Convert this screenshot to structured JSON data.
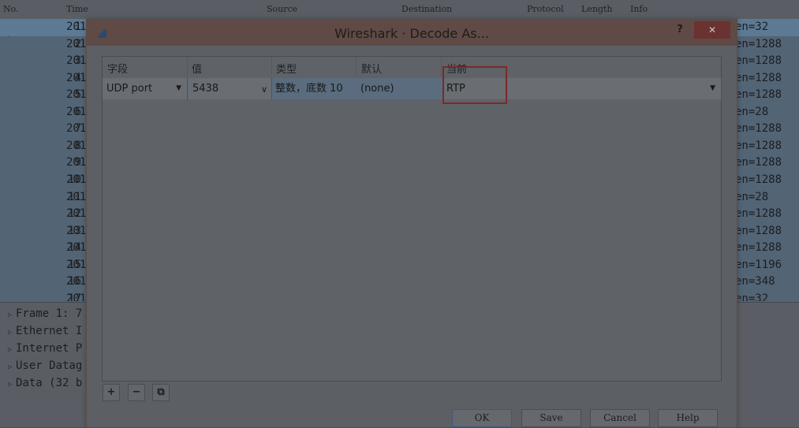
{
  "main": {
    "columns": [
      "No.",
      "Time",
      "Source",
      "Destination",
      "Protocol",
      "Length",
      "Info"
    ],
    "packets": [
      {
        "no": "1",
        "time": "201",
        "info": "en=32"
      },
      {
        "no": "2",
        "time": "201",
        "info": "en=1288"
      },
      {
        "no": "3",
        "time": "201",
        "info": "en=1288"
      },
      {
        "no": "4",
        "time": "201",
        "info": "en=1288"
      },
      {
        "no": "5",
        "time": "201",
        "info": "en=1288"
      },
      {
        "no": "6",
        "time": "201",
        "info": "en=28"
      },
      {
        "no": "7",
        "time": "201",
        "info": "en=1288"
      },
      {
        "no": "8",
        "time": "201",
        "info": "en=1288"
      },
      {
        "no": "9",
        "time": "201",
        "info": "en=1288"
      },
      {
        "no": "10",
        "time": "201",
        "info": "en=1288"
      },
      {
        "no": "11",
        "time": "201",
        "info": "en=28"
      },
      {
        "no": "12",
        "time": "201",
        "info": "en=1288"
      },
      {
        "no": "13",
        "time": "201",
        "info": "en=1288"
      },
      {
        "no": "14",
        "time": "201",
        "info": "en=1288"
      },
      {
        "no": "15",
        "time": "201",
        "info": "en=1196"
      },
      {
        "no": "16",
        "time": "201",
        "info": "en=348"
      },
      {
        "no": "17",
        "time": "201",
        "info": "en=32"
      }
    ],
    "details": [
      "Frame 1: 7",
      "Ethernet I",
      "Internet P",
      "User Datag",
      "Data (32 b"
    ]
  },
  "dialog": {
    "title": "Wireshark · Decode As...",
    "help_label": "?",
    "close_label": "✕",
    "headers": {
      "field": "字段",
      "value": "值",
      "type": "类型",
      "default": "默认",
      "current": "当前"
    },
    "row": {
      "field": "UDP port",
      "value": "5438",
      "type": "整数，底数 10",
      "default": "(none)",
      "current": "RTP"
    },
    "tools": {
      "add": "+",
      "remove": "−",
      "copy": "⧉"
    },
    "buttons": {
      "ok": "OK",
      "save": "Save",
      "cancel": "Cancel",
      "help": "Help"
    }
  },
  "colors": {
    "overlay": "#4a4f55",
    "highlight_box": "#7a2a2a",
    "selected_row": "#5d7a95"
  }
}
